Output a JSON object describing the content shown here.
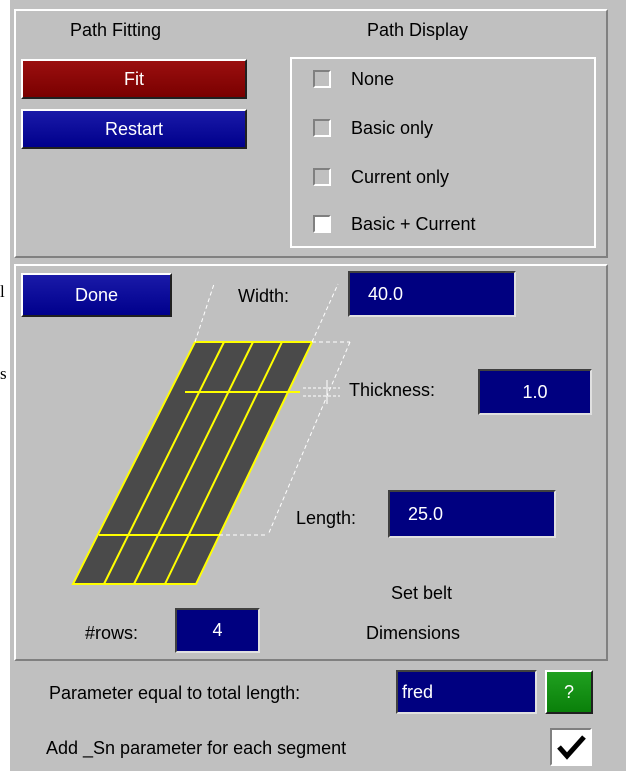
{
  "page_margin": {
    "char_1": "l",
    "char_2": "s"
  },
  "path_fitting": {
    "title": "Path Fitting",
    "fit_label": "Fit",
    "restart_label": "Restart"
  },
  "path_display": {
    "title": "Path Display",
    "options": [
      {
        "label": "None",
        "checked": false
      },
      {
        "label": "Basic only",
        "checked": false
      },
      {
        "label": "Current only",
        "checked": false
      },
      {
        "label": "Basic + Current",
        "checked": true
      }
    ]
  },
  "belt": {
    "done_label": "Done",
    "width_label": "Width:",
    "width_value": "40.0",
    "thickness_label": "Thickness:",
    "thickness_value": "1.0",
    "length_label": "Length:",
    "length_value": "25.0",
    "rows_label": "#rows:",
    "rows_value": "4",
    "caption_line1": "Set belt",
    "caption_line2": "Dimensions"
  },
  "parameter": {
    "label": "Parameter equal to total length:",
    "value": "fred",
    "help_label": "?",
    "sn_label": "Add _Sn parameter for each segment",
    "sn_checked": true
  },
  "colors": {
    "panel_bg": "#c0c0c0",
    "fit_button": "#8b0000",
    "blue_button": "#00008c",
    "field_bg": "#000080",
    "help_button": "#109010",
    "belt_fill": "#4a4a4a",
    "belt_lines": "#ffff00"
  }
}
